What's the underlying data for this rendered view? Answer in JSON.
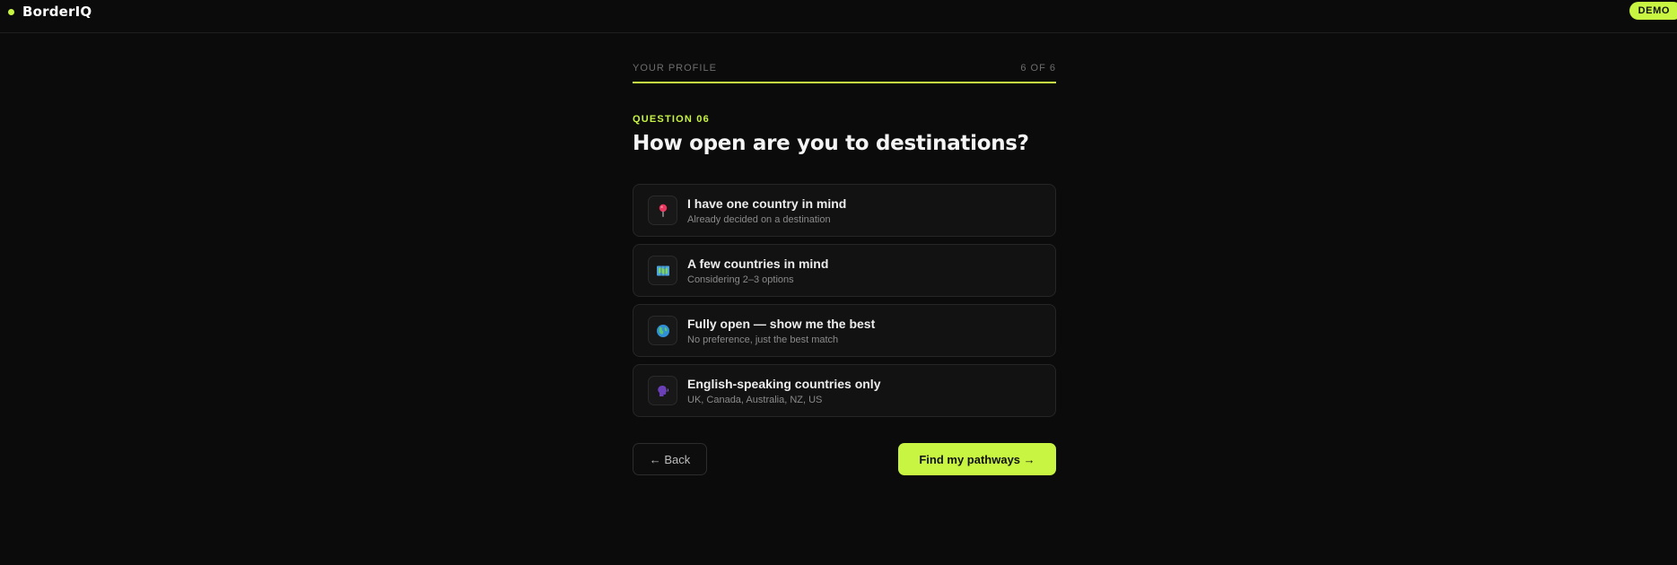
{
  "app": {
    "name": "BorderIQ",
    "badge": "DEMO",
    "accent_color": "#c8f542"
  },
  "progress": {
    "section_label": "YOUR PROFILE",
    "step_label": "6 OF 6",
    "current_step": 6,
    "total_steps": 6,
    "fraction": 1.0
  },
  "question": {
    "kicker": "QUESTION 06",
    "title": "How open are you to destinations?"
  },
  "options": [
    {
      "icon": "round-pushpin-icon",
      "title": "I have one country in mind",
      "subtitle": "Already decided on a destination"
    },
    {
      "icon": "map-icon",
      "title": "A few countries in mind",
      "subtitle": "Considering 2–3 options"
    },
    {
      "icon": "globe-icon",
      "title": "Fully open — show me the best",
      "subtitle": "No preference, just the best match"
    },
    {
      "icon": "speaking-head-icon",
      "title": "English-speaking countries only",
      "subtitle": "UK, Canada, Australia, NZ, US"
    }
  ],
  "nav": {
    "back_label": "← Back",
    "next_label": "Find my pathways →"
  }
}
